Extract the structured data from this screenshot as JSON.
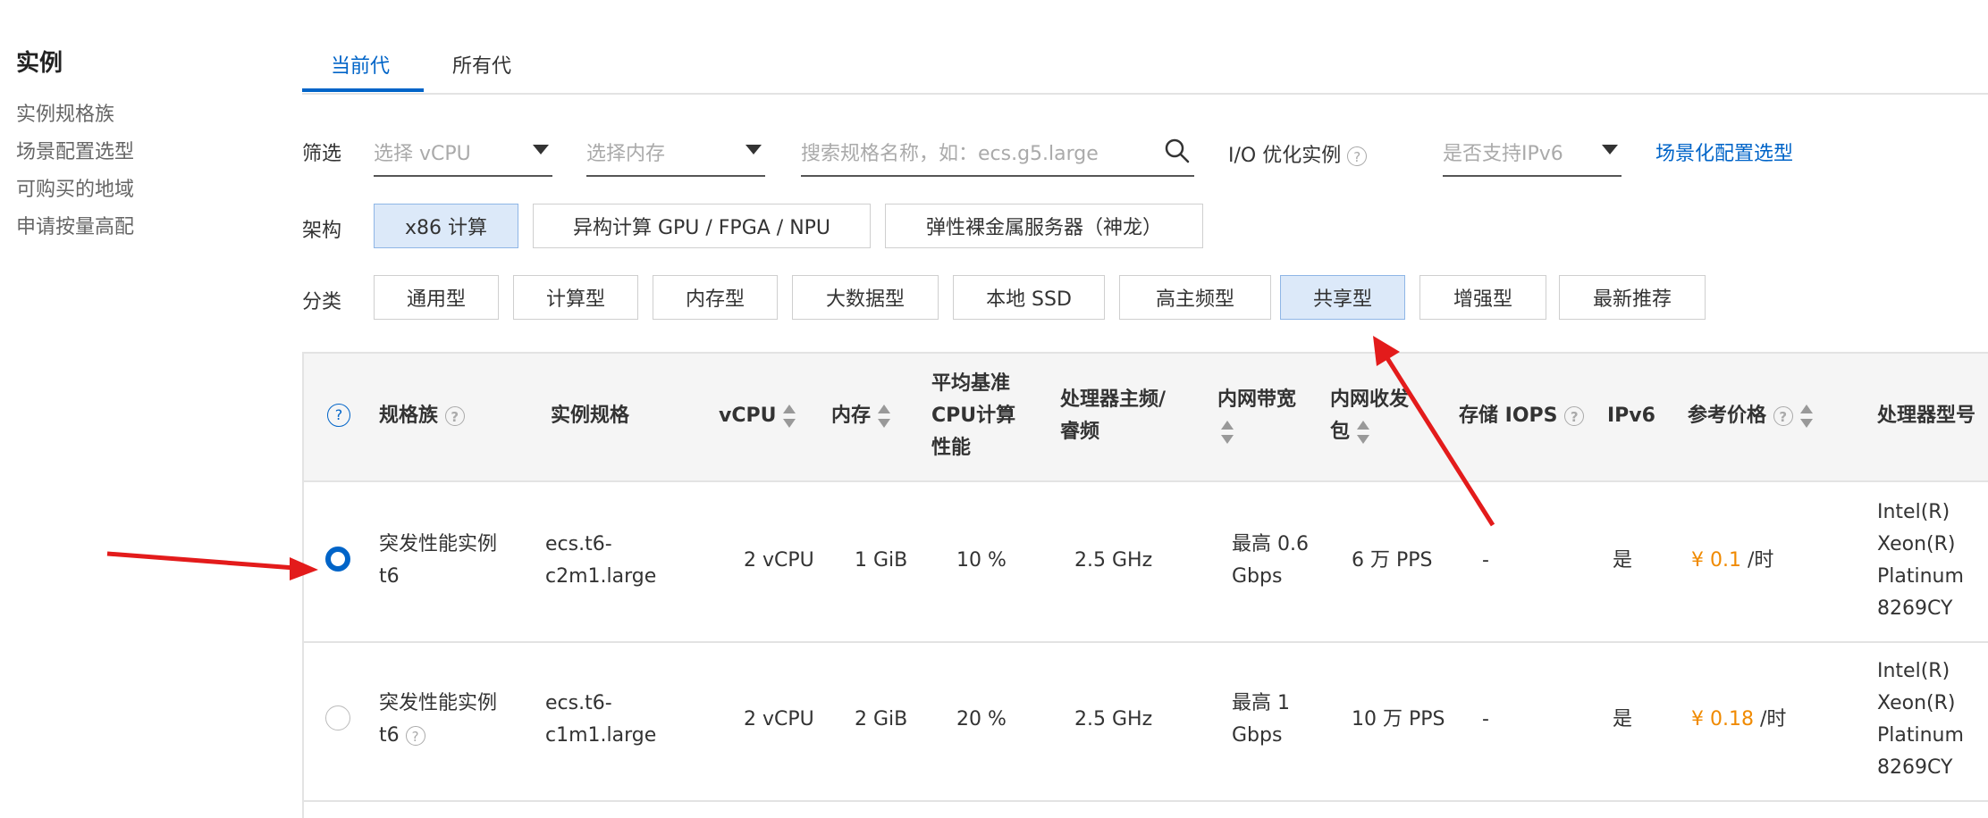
{
  "sidebar": {
    "title": "实例",
    "items": [
      "实例规格族",
      "场景配置选型",
      "可购买的地域",
      "申请按量高配"
    ]
  },
  "tabs": [
    "当前代",
    "所有代"
  ],
  "filter": {
    "label": "筛选",
    "vcpu_placeholder": "选择 vCPU",
    "memory_placeholder": "选择内存",
    "search_placeholder": "搜索规格名称，如：ecs.g5.large",
    "io_label": "I/O 优化实例",
    "ipv6_placeholder": "是否支持IPv6",
    "scenario_link": "场景化配置选型"
  },
  "arch": {
    "label": "架构",
    "options": [
      "x86 计算",
      "异构计算 GPU / FPGA / NPU",
      "弹性裸金属服务器（神龙）"
    ],
    "selected": "x86 计算"
  },
  "category": {
    "label": "分类",
    "options": [
      "通用型",
      "计算型",
      "内存型",
      "大数据型",
      "本地 SSD",
      "高主频型",
      "共享型",
      "增强型",
      "最新推荐"
    ],
    "selected": "共享型"
  },
  "table": {
    "headers": {
      "family": "规格族",
      "spec": "实例规格",
      "vcpu": "vCPU",
      "mem": "内存",
      "baseline_l1": "平均基准",
      "baseline_l2": "CPU计算",
      "baseline_l3": "性能",
      "freq_l1": "处理器主频/",
      "freq_l2": "睿频",
      "bw_l1": "内网带宽",
      "pps_l1": "内网收发",
      "pps_l2": "包",
      "iops": "存储 IOPS",
      "ipv6": "IPv6",
      "price": "参考价格",
      "cpu_model": "处理器型号"
    },
    "rows": [
      {
        "family_l1": "突发性能实例",
        "family_l2": "t6",
        "spec_l1": "ecs.t6-",
        "spec_l2": "c2m1.large",
        "vcpu": "2 vCPU",
        "mem": "1 GiB",
        "baseline": "10 %",
        "freq": "2.5 GHz",
        "bw_l1": "最高 0.6",
        "bw_l2": "Gbps",
        "pps": "6 万 PPS",
        "iops": "-",
        "ipv6": "是",
        "price": "¥ 0.1",
        "price_unit": "/时",
        "cpu_l1": "Intel(R)",
        "cpu_l2": "Xeon(R)",
        "cpu_l3": "Platinum",
        "cpu_l4": "8269CY",
        "selected": true
      },
      {
        "family_l1": "突发性能实例",
        "family_l2": "t6",
        "spec_l1": "ecs.t6-",
        "spec_l2": "c1m1.large",
        "vcpu": "2 vCPU",
        "mem": "2 GiB",
        "baseline": "20 %",
        "freq": "2.5 GHz",
        "bw_l1": "最高 1",
        "bw_l2": "Gbps",
        "pps": "10 万 PPS",
        "iops": "-",
        "ipv6": "是",
        "price": "¥ 0.18",
        "price_unit": "/时",
        "cpu_l1": "Intel(R)",
        "cpu_l2": "Xeon(R)",
        "cpu_l3": "Platinum",
        "cpu_l4": "8269CY",
        "selected": false
      }
    ]
  },
  "colors": {
    "accent": "#0064c8",
    "price": "#f08a00",
    "annotation_arrow": "#e31b1b",
    "chip_selected_bg": "#dce9f9"
  }
}
